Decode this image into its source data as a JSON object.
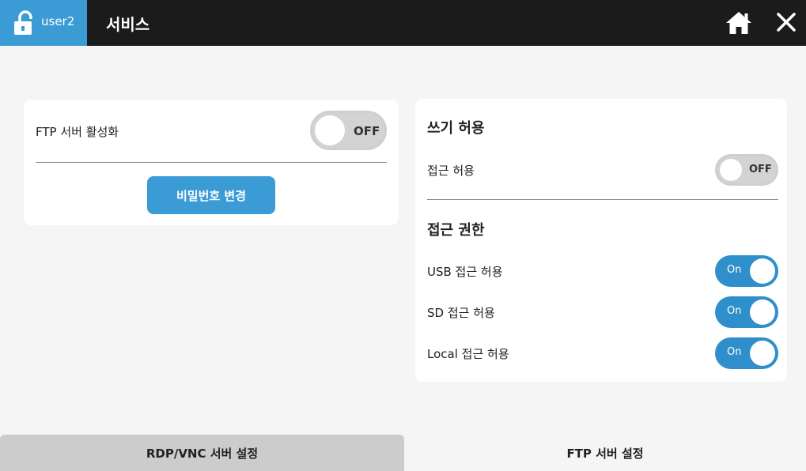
{
  "header": {
    "username": "user2",
    "title": "서비스",
    "icons": [
      "unlock-icon",
      "home-icon",
      "close-icon"
    ]
  },
  "left_card": {
    "ftp_enable_label": "FTP 서버 활성화",
    "ftp_enable_state": "OFF",
    "password_button": "비밀번호 변경"
  },
  "right_card": {
    "write_section_title": "쓰기 허용",
    "write_access_label": "접근 허용",
    "write_access_state": "OFF",
    "access_section_title": "접근 권한",
    "usb_label": "USB 접근 허용",
    "usb_state": "On",
    "sd_label": "SD 접근 허용",
    "sd_state": "On",
    "local_label": "Local 접근 허용",
    "local_state": "On"
  },
  "tabs": {
    "rdp_label": "RDP/VNC 서버 설정",
    "ftp_label": "FTP 서버 설정"
  },
  "colors": {
    "accent": "#3a9bd5",
    "toggle_on": "#2f8fca",
    "topbar": "#1b1b1b"
  }
}
